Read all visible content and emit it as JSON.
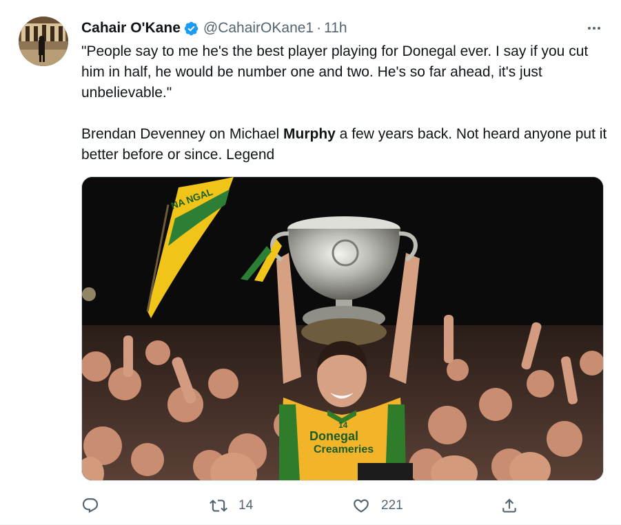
{
  "author": {
    "name": "Cahair O'Kane",
    "handle": "@CahairOKane1",
    "separator": "·",
    "time": "11h",
    "verified": true,
    "verified_color": "#1d9bf0"
  },
  "tweet": {
    "paragraph1": "\"People say to me he's the best player playing for Donegal ever. I say if you cut him in half, he would be number one and two. He's so far ahead, it's just unbelievable.\"",
    "paragraph2_before": "Brendan Devenney on Michael ",
    "paragraph2_bold": "Murphy",
    "paragraph2_after": " a few years back. Not heard anyone put it better before or since. Legend"
  },
  "media": {
    "jersey_text_line1": "Donegal",
    "jersey_text_line2": "Creameries",
    "jersey_number": "14",
    "flag_text": "NA NGAL",
    "colors": {
      "jersey_yellow": "#f2b52a",
      "jersey_green": "#2f7d2a",
      "trophy_silver": "#c9c9c4",
      "background": "#0b0b0c"
    }
  },
  "actions": {
    "reply_count": "",
    "retweet_count": "14",
    "like_count": "221",
    "share_count": ""
  },
  "icons": {
    "more": "more-icon",
    "reply": "reply-icon",
    "retweet": "retweet-icon",
    "like": "heart-icon",
    "share": "share-icon"
  }
}
